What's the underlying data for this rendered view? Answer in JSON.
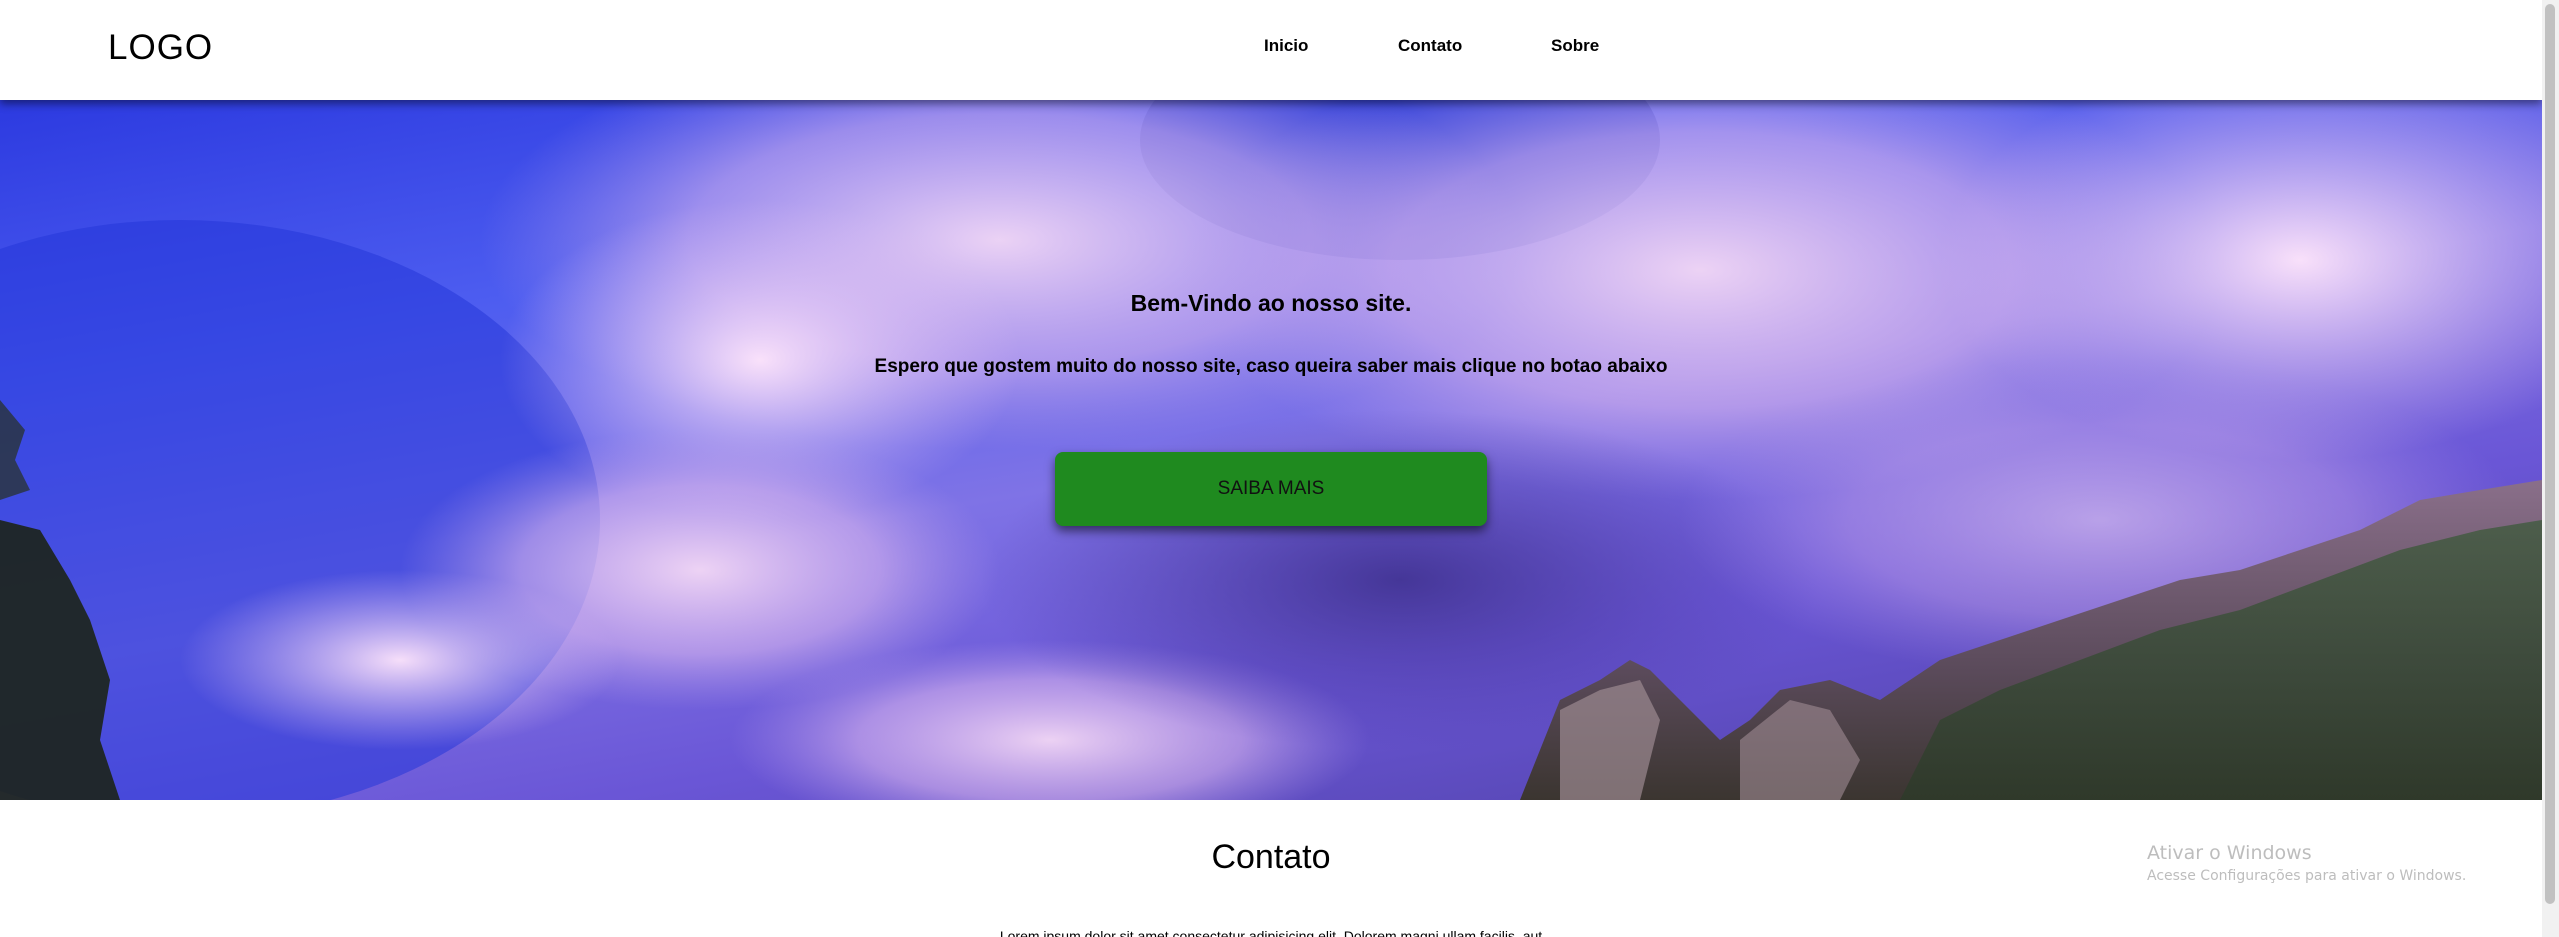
{
  "header": {
    "logo": "LOGO",
    "nav": [
      "Inicio",
      "Contato",
      "Sobre"
    ]
  },
  "hero": {
    "title": "Bem-Vindo ao nosso site.",
    "subtitle": "Espero que gostem muito do nosso site, caso queira saber mais clique no botao abaixo",
    "button_label": "SAIBA MAIS"
  },
  "contato": {
    "title": "Contato",
    "text": "Lorem ipsum dolor sit amet consectetur adipisicing elit. Dolorem magni ullam facilis, aut"
  },
  "watermark": {
    "title": "Ativar o Windows",
    "subtitle": "Acesse Configurações para ativar o Windows."
  },
  "colors": {
    "button": "#1f8a1f",
    "header_bg": "#ffffff"
  }
}
